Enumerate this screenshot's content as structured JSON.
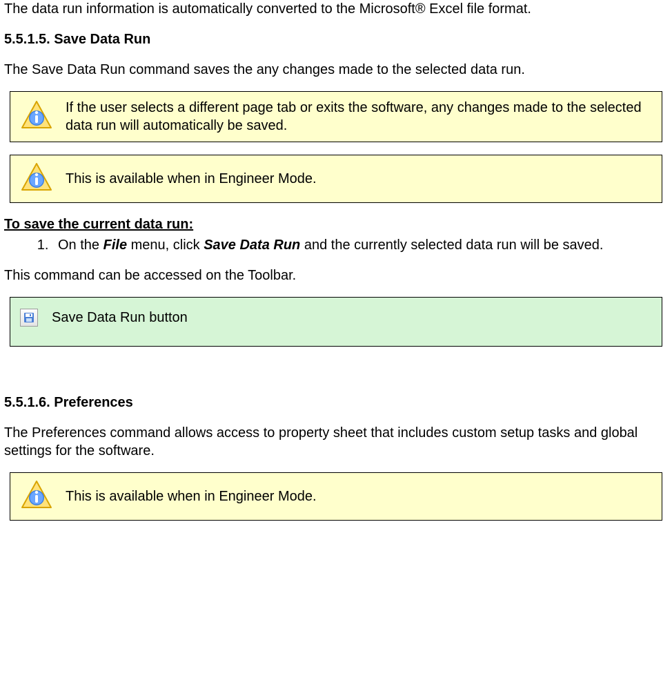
{
  "intro_para": "The data run information is automatically converted to the Microsoft® Excel file format.",
  "section_5_5_1_5": {
    "heading": "5.5.1.5. Save Data Run",
    "para": "The Save Data Run command saves the any changes made to the selected data run.",
    "note1": "If the user selects a different page tab or exits the software, any changes made to the selected data run will automatically be saved.",
    "note2": "This is available when in Engineer Mode.",
    "howto_heading": "To save the current data run:",
    "step1_prefix": "On the ",
    "step1_menu": "File",
    "step1_mid": " menu, click ",
    "step1_cmd": "Save Data Run",
    "step1_suffix": " and the currently selected data run will be saved.",
    "toolbar_para": "This command can be accessed on the Toolbar.",
    "toolbar_button_label": "Save Data Run button"
  },
  "section_5_5_1_6": {
    "heading": "5.5.1.6. Preferences",
    "para": "The Preferences command allows access to property sheet that includes custom setup tasks and global settings for the software.",
    "note": "This is available when in Engineer Mode."
  }
}
